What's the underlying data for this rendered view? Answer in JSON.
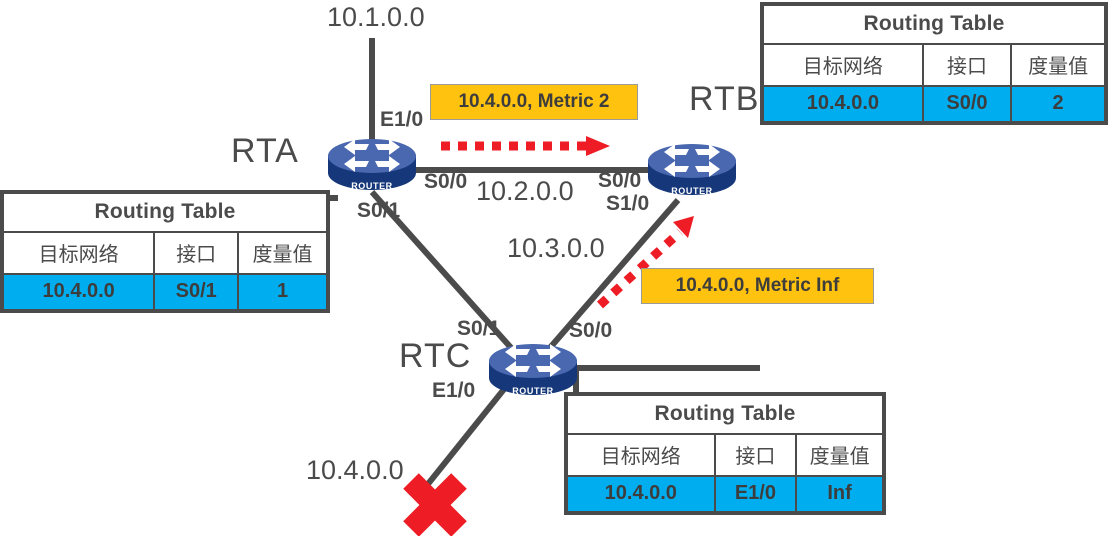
{
  "diagram": {
    "title": "RIP route poisoning / triggered update topology",
    "colors": {
      "line": "#4b4b4b",
      "table_row_fill": "#00aeef",
      "callout_fill": "#ffc20e",
      "alert": "#ee1c25",
      "router_body": "#4a68b0",
      "router_base": "#16387a"
    }
  },
  "tables": [
    {
      "id": "table-rta",
      "owner": "RTA",
      "title": "Routing Table",
      "headers": [
        "目标网络",
        "接口",
        "度量值"
      ],
      "rows": [
        [
          "10.4.0.0",
          "S0/1",
          "1"
        ]
      ]
    },
    {
      "id": "table-rtb",
      "owner": "RTB",
      "title": "Routing Table",
      "headers": [
        "目标网络",
        "接口",
        "度量值"
      ],
      "rows": [
        [
          "10.4.0.0",
          "S0/0",
          "2"
        ]
      ]
    },
    {
      "id": "table-rtc",
      "owner": "RTC",
      "title": "Routing Table",
      "headers": [
        "目标网络",
        "接口",
        "度量值"
      ],
      "rows": [
        [
          "10.4.0.0",
          "E1/0",
          "Inf"
        ]
      ]
    }
  ],
  "callouts": [
    {
      "id": "callout-metric2",
      "text": "10.4.0.0, Metric 2"
    },
    {
      "id": "callout-metricinf",
      "text": "10.4.0.0, Metric Inf"
    }
  ],
  "routers": [
    {
      "id": "router-rta",
      "name": "RTA",
      "icon": "router-icon",
      "caption": "ROUTER"
    },
    {
      "id": "router-rtb",
      "name": "RTB",
      "icon": "router-icon",
      "caption": "ROUTER"
    },
    {
      "id": "router-rtc",
      "name": "RTC",
      "icon": "router-icon",
      "caption": "ROUTER"
    }
  ],
  "router_labels": {
    "rta": "RTA",
    "rtb": "RTB",
    "rtc": "RTC"
  },
  "networks": {
    "n1": "10.1.0.0",
    "n2": "10.2.0.0",
    "n3": "10.3.0.0",
    "n4": "10.4.0.0"
  },
  "interfaces": {
    "rta_e1_0": "E1/0",
    "rta_s0_0": "S0/0",
    "rta_s0_1": "S0/1",
    "rtb_s0_0": "S0/0",
    "rtb_s1_0": "S1/0",
    "rtc_s0_1": "S0/1",
    "rtc_s0_0": "S0/0",
    "rtc_e1_0": "E1/0"
  },
  "annotations": {
    "link_down_marker": "red-x-mark",
    "update_arrow_rta_to_rtb": "red-dashed-arrow-right",
    "update_arrow_rtc_to_rtb": "red-dashed-arrow-diagonal"
  }
}
